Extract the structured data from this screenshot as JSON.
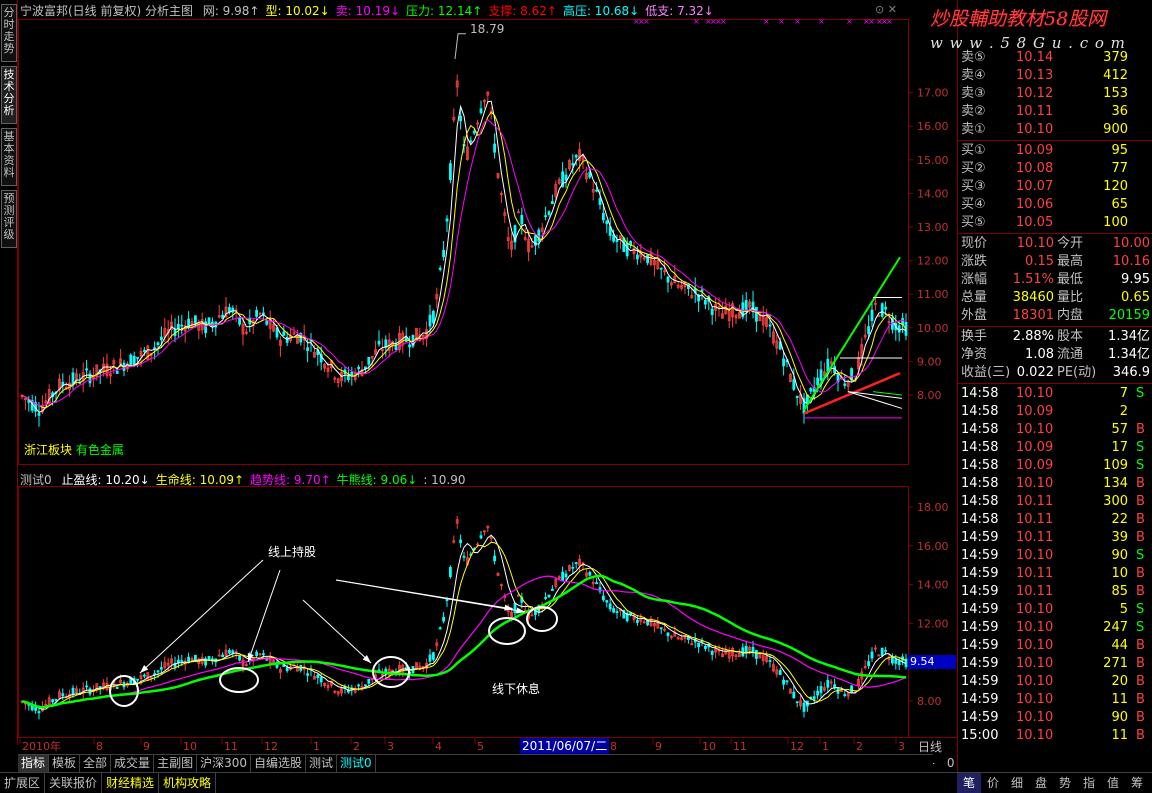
{
  "stock": {
    "title": "宁波富邦(日线 前复权) 分析主图",
    "indicators": [
      {
        "label": "网:",
        "value": "9.98",
        "arrow": "↑",
        "color": "#c0c0c0"
      },
      {
        "label": "型:",
        "value": "10.02",
        "arrow": "↓",
        "color": "#ffff00"
      },
      {
        "label": "卖:",
        "value": "10.19",
        "arrow": "↓",
        "color": "#ff00ff"
      },
      {
        "label": "压力:",
        "value": "12.14",
        "arrow": "↑",
        "color": "#00ff00"
      },
      {
        "label": "支撑:",
        "value": "8.62",
        "arrow": "↑",
        "color": "#ff0000"
      },
      {
        "label": "高压:",
        "value": "10.68",
        "arrow": "↓",
        "color": "#00ffff"
      },
      {
        "label": "低支:",
        "value": "7.32",
        "arrow": "↓",
        "color": "#ff80ff"
      }
    ],
    "sector_label": "浙江板块",
    "sector_label2": "有色金属"
  },
  "sidebar": {
    "tabs": [
      "分时走势",
      "技术分析",
      "基本资料",
      "预测评级"
    ]
  },
  "main_chart": {
    "peak_label": "18.79",
    "y_ticks": [
      "17.00",
      "16.00",
      "15.00",
      "14.00",
      "13.00",
      "12.00",
      "11.00",
      "10.00",
      "9.00",
      "8.00"
    ]
  },
  "indicator_chart": {
    "name": "测试0",
    "items": [
      {
        "label": "止盈线:",
        "value": "10.20",
        "arrow": "↓",
        "color": "#ffffff"
      },
      {
        "label": "生命线:",
        "value": "10.09",
        "arrow": "↑",
        "color": "#ffff00"
      },
      {
        "label": "趋势线:",
        "value": "9.70",
        "arrow": "↑",
        "color": "#ff00ff"
      },
      {
        "label": "牛熊线:",
        "value": "9.06",
        "arrow": "↓",
        "color": "#00ff00"
      },
      {
        "label": ":",
        "value": "10.90",
        "arrow": "",
        "color": "#c0c0c0"
      }
    ],
    "y_ticks": [
      "18.00",
      "16.00",
      "14.00",
      "12.00",
      "10.00",
      "8.00"
    ],
    "current_value": "9.54",
    "annotation_hold": "线上持股",
    "annotation_rest": "线下休息"
  },
  "x_axis": {
    "labels": [
      "2010年",
      "8",
      "9",
      "10",
      "11",
      "12",
      "1",
      "2",
      "3",
      "4",
      "5",
      "6",
      "8",
      "9",
      "10",
      "11",
      "12",
      "1",
      "2",
      "3"
    ],
    "cursor_date": "2011/06/07/二",
    "period": "日线"
  },
  "quote": {
    "asks": [
      {
        "label": "卖⑤",
        "price": "10.14",
        "vol": "379"
      },
      {
        "label": "卖④",
        "price": "10.13",
        "vol": "412"
      },
      {
        "label": "卖③",
        "price": "10.12",
        "vol": "153"
      },
      {
        "label": "卖②",
        "price": "10.11",
        "vol": "36"
      },
      {
        "label": "卖①",
        "price": "10.10",
        "vol": "900"
      }
    ],
    "bids": [
      {
        "label": "买①",
        "price": "10.09",
        "vol": "95"
      },
      {
        "label": "买②",
        "price": "10.08",
        "vol": "77"
      },
      {
        "label": "买③",
        "price": "10.07",
        "vol": "120"
      },
      {
        "label": "买④",
        "price": "10.06",
        "vol": "65"
      },
      {
        "label": "买⑤",
        "price": "10.05",
        "vol": "100"
      }
    ],
    "stats": [
      {
        "l1": "现价",
        "v1": "10.10",
        "c1": "#ff4040",
        "l2": "今开",
        "v2": "10.00",
        "c2": "#ff4040"
      },
      {
        "l1": "涨跌",
        "v1": "0.15",
        "c1": "#ff4040",
        "l2": "最高",
        "v2": "10.16",
        "c2": "#ff4040"
      },
      {
        "l1": "涨幅",
        "v1": "1.51%",
        "c1": "#ff4040",
        "l2": "最低",
        "v2": "9.95",
        "c2": "#ffffff"
      },
      {
        "l1": "总量",
        "v1": "38460",
        "c1": "#ffff00",
        "l2": "量比",
        "v2": "0.65",
        "c2": "#ffff00"
      },
      {
        "l1": "外盘",
        "v1": "18301",
        "c1": "#ff4040",
        "l2": "内盘",
        "v2": "20159",
        "c2": "#00ff00"
      }
    ],
    "fundamentals": [
      {
        "l1": "换手",
        "v1": "2.88%",
        "l2": "股本",
        "v2": "1.34亿"
      },
      {
        "l1": "净资",
        "v1": "1.08",
        "l2": "流通",
        "v2": "1.34亿"
      },
      {
        "l1": "收益(三)",
        "v1": "0.022",
        "l2": "PE(动)",
        "v2": "346.9"
      }
    ],
    "ticks": [
      {
        "time": "14:58",
        "price": "10.10",
        "pc": "#ff4040",
        "vol": "7",
        "side": "S"
      },
      {
        "time": "14:58",
        "price": "10.09",
        "pc": "#ff4040",
        "vol": "2",
        "side": ""
      },
      {
        "time": "14:58",
        "price": "10.10",
        "pc": "#ff4040",
        "vol": "57",
        "side": "B"
      },
      {
        "time": "14:58",
        "price": "10.09",
        "pc": "#ff4040",
        "vol": "17",
        "side": "S"
      },
      {
        "time": "14:58",
        "price": "10.09",
        "pc": "#ff4040",
        "vol": "109",
        "side": "S"
      },
      {
        "time": "14:58",
        "price": "10.10",
        "pc": "#ff4040",
        "vol": "134",
        "side": "B"
      },
      {
        "time": "14:58",
        "price": "10.11",
        "pc": "#ff4040",
        "vol": "300",
        "side": "B"
      },
      {
        "time": "14:58",
        "price": "10.11",
        "pc": "#ff4040",
        "vol": "22",
        "side": "B"
      },
      {
        "time": "14:59",
        "price": "10.11",
        "pc": "#ff4040",
        "vol": "39",
        "side": "B"
      },
      {
        "time": "14:59",
        "price": "10.10",
        "pc": "#ff4040",
        "vol": "90",
        "side": "S"
      },
      {
        "time": "14:59",
        "price": "10.11",
        "pc": "#ff4040",
        "vol": "10",
        "side": "B"
      },
      {
        "time": "14:59",
        "price": "10.11",
        "pc": "#ff4040",
        "vol": "85",
        "side": "B"
      },
      {
        "time": "14:59",
        "price": "10.10",
        "pc": "#ff4040",
        "vol": "5",
        "side": "S"
      },
      {
        "time": "14:59",
        "price": "10.10",
        "pc": "#ff4040",
        "vol": "247",
        "side": "S"
      },
      {
        "time": "14:59",
        "price": "10.10",
        "pc": "#ff4040",
        "vol": "44",
        "side": "B"
      },
      {
        "time": "14:59",
        "price": "10.10",
        "pc": "#ff4040",
        "vol": "271",
        "side": "B"
      },
      {
        "time": "14:59",
        "price": "10.10",
        "pc": "#ff4040",
        "vol": "20",
        "side": "B"
      },
      {
        "time": "14:59",
        "price": "10.10",
        "pc": "#ff4040",
        "vol": "11",
        "side": "B"
      },
      {
        "time": "14:59",
        "price": "10.10",
        "pc": "#ff4040",
        "vol": "90",
        "side": "B"
      },
      {
        "time": "15:00",
        "price": "10.10",
        "pc": "#ff4040",
        "vol": "11",
        "side": "B"
      }
    ]
  },
  "bottom_tabs": [
    "指标",
    "模板",
    "全部",
    "成交量",
    "主副图",
    "沪深300",
    "自编选股",
    "测试",
    "测试0"
  ],
  "status_tabs": [
    "扩展区",
    "关联报价",
    "财经精选",
    "机构攻略"
  ],
  "right_bottom_tabs": [
    "笔",
    "价",
    "细",
    "盘",
    "势",
    "指",
    "值",
    "筹"
  ],
  "zoom_controls": [
    "+",
    "-",
    "0"
  ],
  "watermark": {
    "text": "炒股輔助教材58股网",
    "url": "w w w . 5 8 G u . c o m"
  },
  "colors": {
    "up": "#ff4040",
    "down": "#00ffff",
    "bg": "#000000",
    "grid": "#800000",
    "bull_bear": "#00ff00",
    "trend": "#ff00ff"
  }
}
